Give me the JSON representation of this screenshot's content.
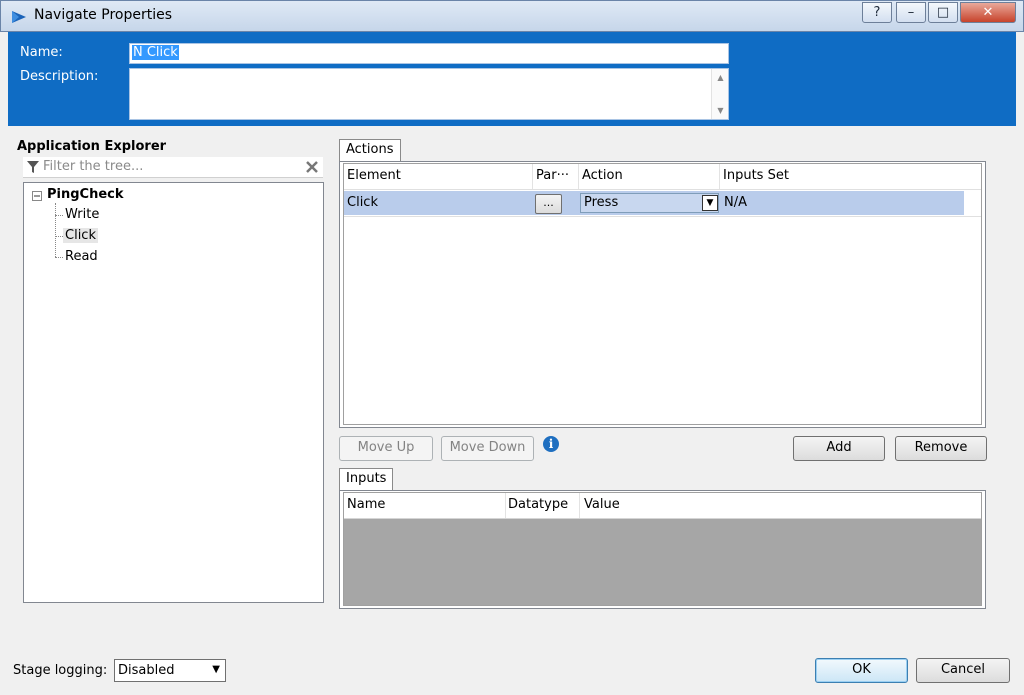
{
  "window": {
    "title": "Navigate Properties",
    "controls": [
      "?",
      "–",
      "□",
      "✕"
    ]
  },
  "header": {
    "name_label": "Name:",
    "name_value": "N Click",
    "description_label": "Description:",
    "description_value": ""
  },
  "explorer": {
    "title": "Application Explorer",
    "filter_placeholder": "Filter the tree...",
    "root": "PingCheck",
    "items": [
      "Write",
      "Click",
      "Read"
    ],
    "selected": "Click"
  },
  "actions": {
    "tab_label": "Actions",
    "columns": [
      "Element",
      "Par···",
      "Action",
      "Inputs Set"
    ],
    "rows": [
      {
        "element": "Click",
        "params_button": "...",
        "action": "Press",
        "inputs_set": "N/A"
      }
    ],
    "move_up_label": "Move Up",
    "move_down_label": "Move Down",
    "info_icon": "i",
    "add_label": "Add",
    "remove_label": "Remove"
  },
  "inputs": {
    "tab_label": "Inputs",
    "columns": [
      "Name",
      "Datatype",
      "Value"
    ]
  },
  "footer": {
    "stage_logging_label": "Stage logging:",
    "stage_logging_value": "Disabled",
    "ok_label": "OK",
    "cancel_label": "Cancel"
  },
  "colors": {
    "header_blue": "#0f6cc4",
    "selection_blue": "#b9cceb",
    "info_blue": "#1f6fc0"
  }
}
